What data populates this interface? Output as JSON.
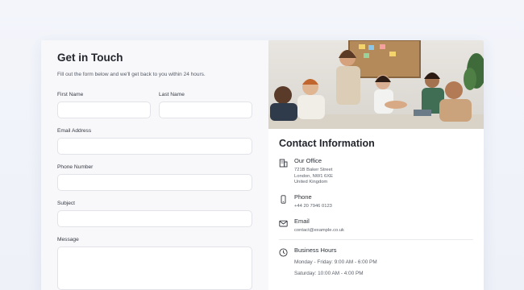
{
  "form": {
    "title": "Get in Touch",
    "subtitle": "Fill out the form below and we'll get back to you within 24 hours.",
    "first_name_label": "First Name",
    "last_name_label": "Last Name",
    "email_label": "Email Address",
    "phone_label": "Phone Number",
    "subject_label": "Subject",
    "message_label": "Message"
  },
  "contact": {
    "title": "Contact Information",
    "office": {
      "title": "Our Office",
      "lines": [
        "721B Baker Street",
        "London, NW1 6XE",
        "United Kingdom"
      ],
      "icon": "building-icon"
    },
    "phone": {
      "title": "Phone",
      "value": "+44 20 7946 0123",
      "icon": "phone-icon"
    },
    "email": {
      "title": "Email",
      "value": "contact@example.co.uk",
      "icon": "mail-icon"
    },
    "hours": {
      "title": "Business Hours",
      "lines": [
        "Monday - Friday: 9:00 AM - 6:00 PM",
        "Saturday: 10:00 AM - 4:00 PM"
      ],
      "icon": "clock-icon"
    }
  },
  "colors": {
    "page_bg": "#f1f3f9",
    "form_bg": "#f8f8fa",
    "text_dark": "#23262d",
    "input_border": "#e1e3e8"
  }
}
